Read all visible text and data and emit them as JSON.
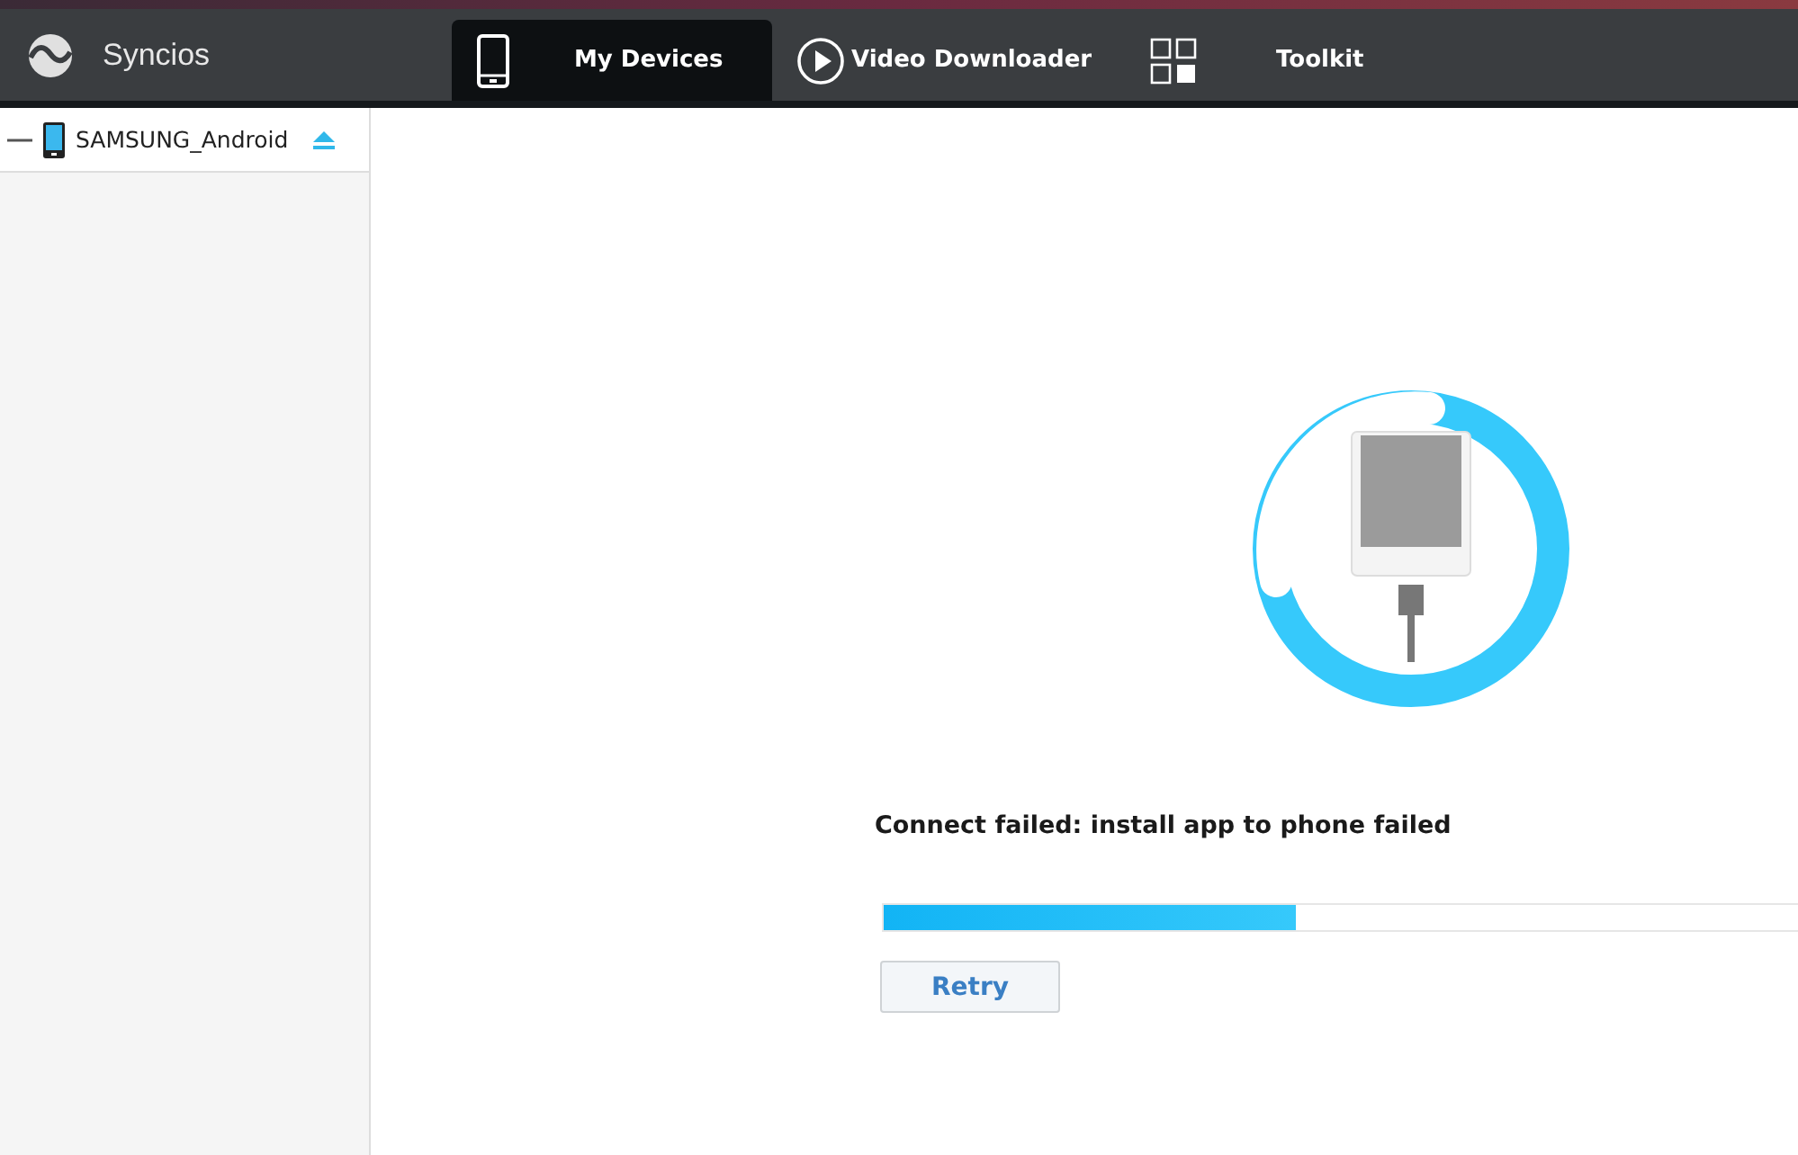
{
  "app": {
    "name": "Syncios"
  },
  "tabs": [
    {
      "label": "My Devices",
      "kind": "phone",
      "selected": true
    },
    {
      "label": "Video Downloader",
      "kind": "play",
      "selected": false
    },
    {
      "label": "Toolkit",
      "kind": "grid",
      "selected": false
    }
  ],
  "sidebar": {
    "device": {
      "name": "SAMSUNG_Android",
      "expanded": true
    }
  },
  "status": {
    "message": "Connect failed: install app to phone failed",
    "progress": {
      "level": 0.45
    },
    "button": "Retry"
  }
}
